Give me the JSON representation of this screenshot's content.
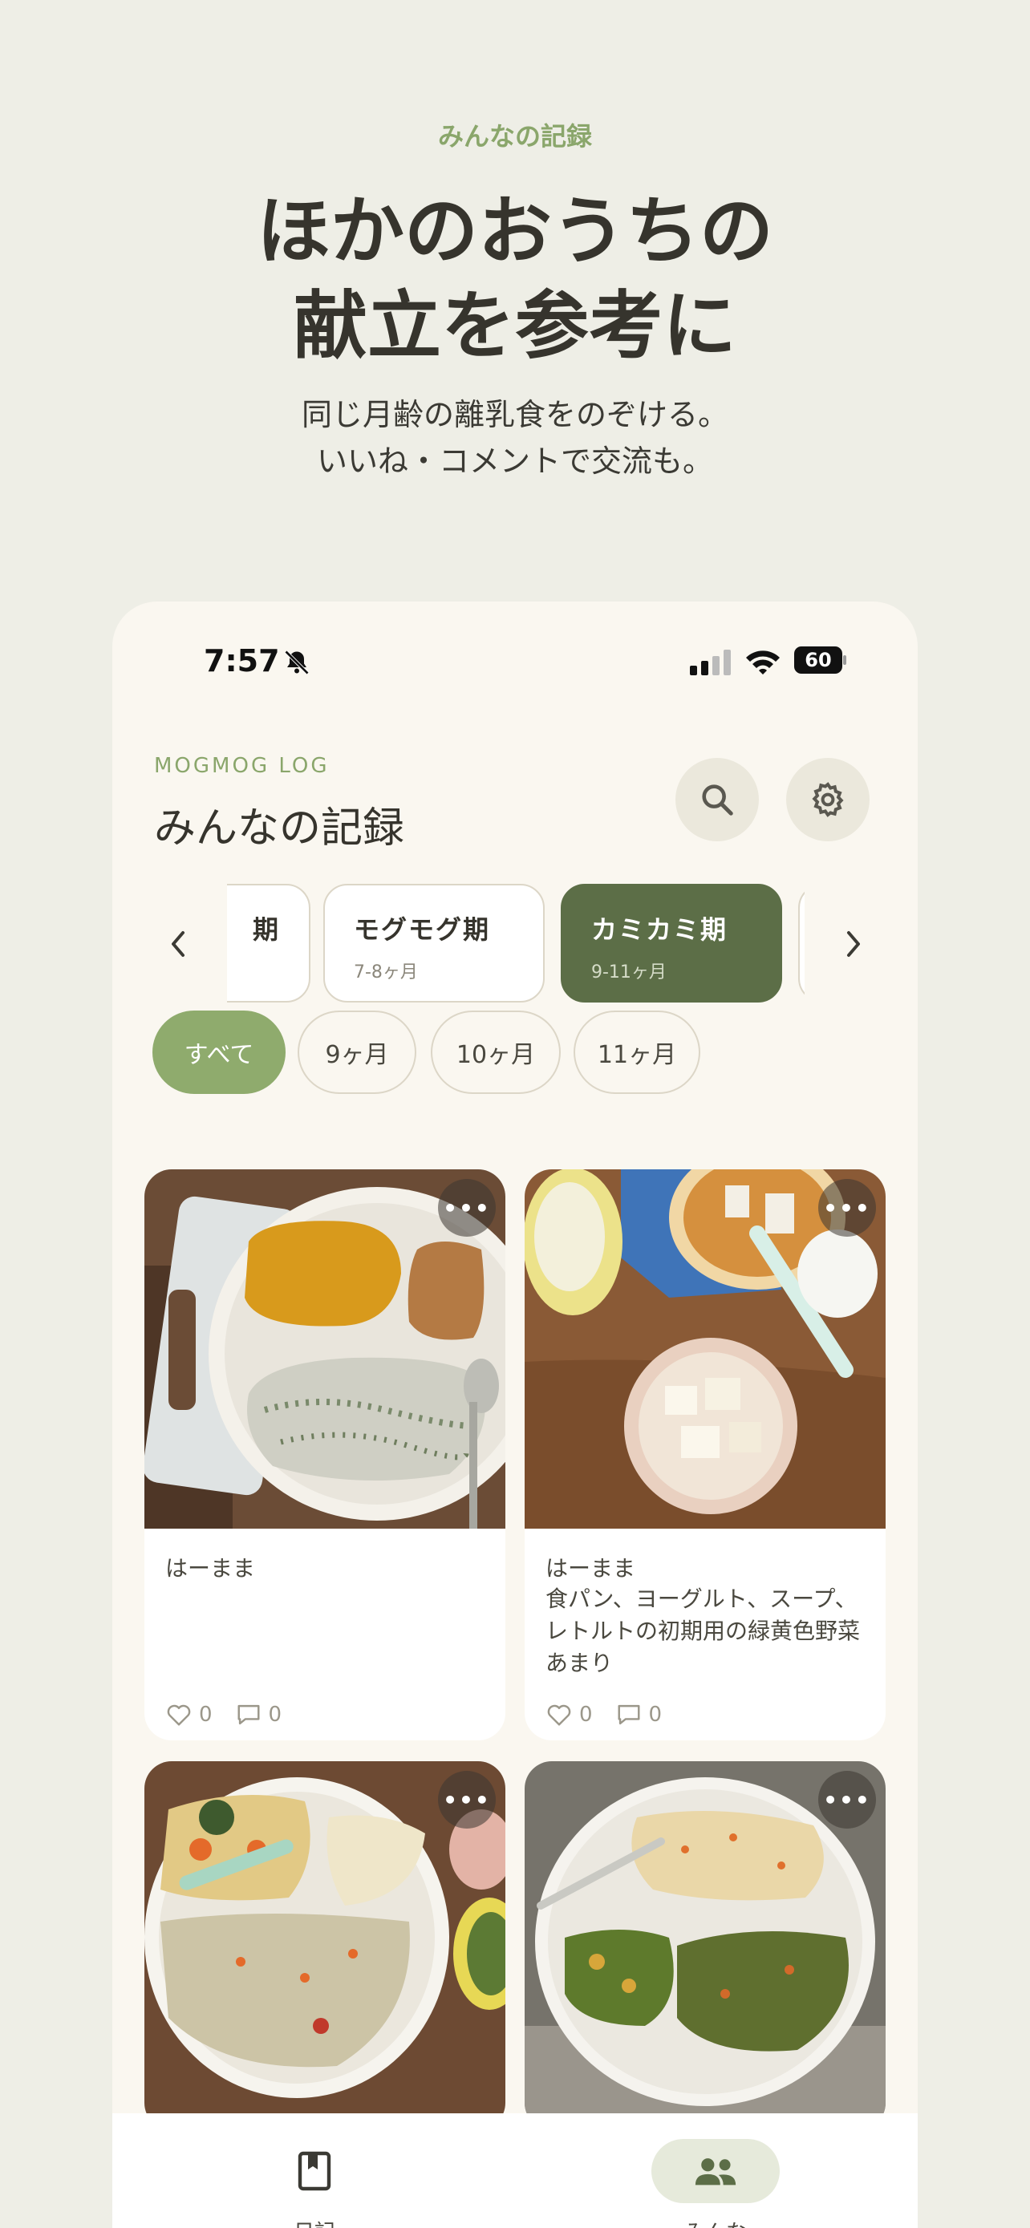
{
  "hero": {
    "kicker": "みんなの記録",
    "title_line1": "ほかのおうちの",
    "title_line2": "献立を参考に",
    "sub_line1": "同じ月齢の離乳食をのぞける。",
    "sub_line2": "いいね・コメントで交流も。"
  },
  "status_bar": {
    "time": "7:57",
    "battery": "60",
    "icons": [
      "bell-off-icon",
      "cellular-signal-icon",
      "wifi-icon",
      "battery-icon"
    ]
  },
  "header": {
    "brand": "MOGMOG LOG",
    "title": "みんなの記録",
    "buttons": [
      "search-icon",
      "gear-icon"
    ]
  },
  "periods": [
    {
      "name": "期",
      "range": ""
    },
    {
      "name": "モグモグ期",
      "range": "7-8ヶ月"
    },
    {
      "name": "カミカミ期",
      "range": "9-11ヶ月",
      "selected": true
    }
  ],
  "months": [
    {
      "label": "すべて",
      "selected": true
    },
    {
      "label": "9ヶ月"
    },
    {
      "label": "10ヶ月"
    },
    {
      "label": "11ヶ月"
    }
  ],
  "posts": [
    {
      "author": "はーまま",
      "note": "",
      "likes": "0",
      "comments": "0"
    },
    {
      "author": "はーまま",
      "note": "食パン、ヨーグルト、スープ、レトルトの初期用の緑黄色野菜あまり",
      "likes": "0",
      "comments": "0"
    },
    {
      "author": "",
      "note": "",
      "likes": "",
      "comments": ""
    },
    {
      "author": "",
      "note": "",
      "likes": "",
      "comments": ""
    }
  ],
  "more_label": "•••",
  "tabs": [
    {
      "label": "日記",
      "icon": "book-icon"
    },
    {
      "label": "みんな",
      "icon": "people-icon",
      "selected": true
    }
  ],
  "colors": {
    "accent": "#8fab6d",
    "accent_dark": "#5c6e47",
    "background": "#eeeee6",
    "surface": "#faf7f0"
  }
}
